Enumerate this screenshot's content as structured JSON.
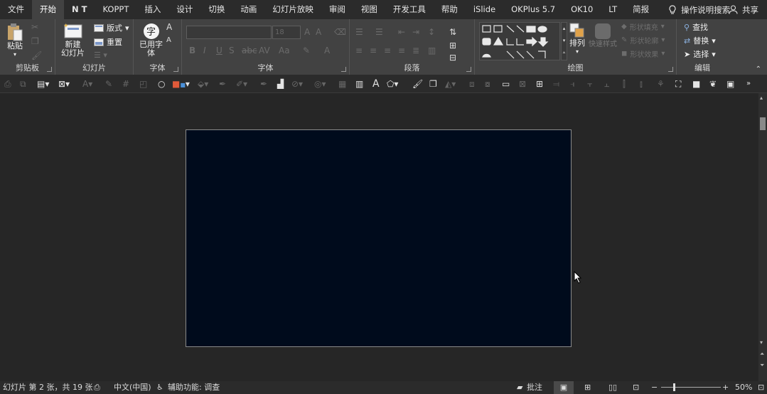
{
  "tabs": [
    {
      "label": "文件",
      "active": false
    },
    {
      "label": "开始",
      "active": true
    },
    {
      "label": "N T",
      "active": false
    },
    {
      "label": "KOPPT",
      "active": false
    },
    {
      "label": "插入",
      "active": false
    },
    {
      "label": "设计",
      "active": false
    },
    {
      "label": "切换",
      "active": false
    },
    {
      "label": "动画",
      "active": false
    },
    {
      "label": "幻灯片放映",
      "active": false
    },
    {
      "label": "审阅",
      "active": false
    },
    {
      "label": "视图",
      "active": false
    },
    {
      "label": "开发工具",
      "active": false
    },
    {
      "label": "帮助",
      "active": false
    },
    {
      "label": "iSlide",
      "active": false
    },
    {
      "label": "OKPlus 5.7",
      "active": false
    },
    {
      "label": "OK10",
      "active": false
    },
    {
      "label": "LT",
      "active": false
    },
    {
      "label": "简报",
      "active": false
    }
  ],
  "tellme": "操作说明搜索",
  "share": "共享",
  "ribbon": {
    "clipboard": {
      "label": "剪贴板",
      "paste": "粘贴"
    },
    "slides": {
      "label": "幻灯片",
      "new_slide_1": "新建",
      "new_slide_2": "幻灯片",
      "layout": "版式",
      "reset": "重置"
    },
    "font_used": {
      "label": "字体",
      "used_1": "已用字",
      "used_2": "体"
    },
    "font": {
      "label": "字体",
      "font_size_placeholder": "18"
    },
    "paragraph": {
      "label": "段落"
    },
    "drawing": {
      "label": "绘图",
      "arrange": "排列",
      "quick_styles": "快速样式",
      "shape_fill": "形状填充",
      "shape_outline": "形状轮廓",
      "shape_effects": "形状效果"
    },
    "editing": {
      "label": "编辑",
      "find": "查找",
      "replace": "替换",
      "select": "选择"
    }
  },
  "status": {
    "slide_info": "幻灯片 第 2 张，共 19 张",
    "language": "中文(中国)",
    "accessibility": "辅助功能: 调查",
    "comments": "批注",
    "zoom": "50%"
  },
  "colors": {
    "slide_background": "#000b1c",
    "ribbon_background": "#424242",
    "app_background": "#2b2b2b"
  }
}
